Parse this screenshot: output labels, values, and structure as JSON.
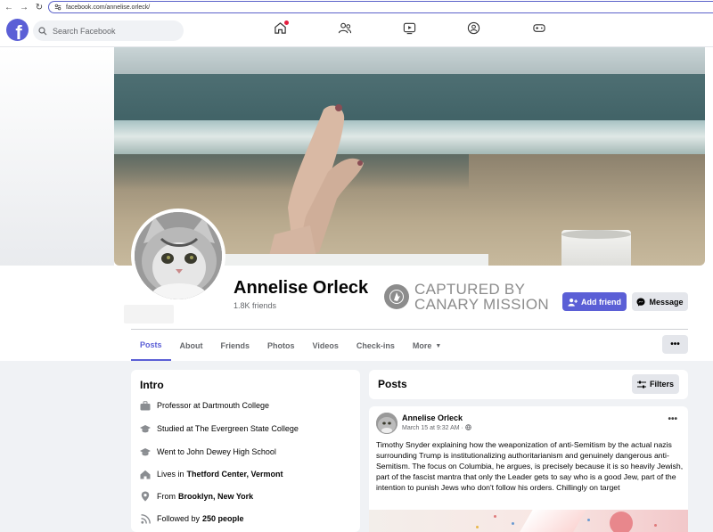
{
  "browser": {
    "url": "facebook.com/annelise.orleck/"
  },
  "header": {
    "search_placeholder": "Search Facebook"
  },
  "profile": {
    "name": "Annelise Orleck",
    "friends": "1.8K friends",
    "watermark_line1": "CAPTURED BY",
    "watermark_line2": "CANARY MISSION",
    "add_friend_label": "Add friend",
    "message_label": "Message"
  },
  "tabs": [
    {
      "label": "Posts",
      "active": true
    },
    {
      "label": "About"
    },
    {
      "label": "Friends"
    },
    {
      "label": "Photos"
    },
    {
      "label": "Videos"
    },
    {
      "label": "Check-ins"
    },
    {
      "label": "More"
    }
  ],
  "intro": {
    "title": "Intro",
    "items": [
      {
        "icon": "briefcase-icon",
        "text": "Professor at Dartmouth College",
        "bold": ""
      },
      {
        "icon": "graduation-cap-icon",
        "text": "Studied at The Evergreen State College",
        "bold": ""
      },
      {
        "icon": "graduation-cap-icon",
        "text": "Went to John Dewey High School",
        "bold": ""
      },
      {
        "icon": "home-icon",
        "text": "Lives in",
        "bold": "Thetford Center, Vermont"
      },
      {
        "icon": "location-pin-icon",
        "text": "From",
        "bold": "Brooklyn, New York"
      },
      {
        "icon": "rss-icon",
        "text": "Followed by",
        "bold": "250 people"
      }
    ]
  },
  "posts": {
    "title": "Posts",
    "filters_label": "Filters",
    "items": [
      {
        "author": "Annelise Orleck",
        "date": "March 15 at 9:32 AM",
        "text": "Timothy Snyder explaining how the weaponization of anti-Semitism by the actual nazis surrounding Trump is institutionalizing authoritarianism and genuinely dangerous anti-Semitism. The focus on Columbia, he argues, is precisely because it is so heavily Jewish, part of the fascist mantra that only the Leader gets to say who is a good Jew, part of the intention to punish Jews who don't follow his orders. Chillingly on target"
      }
    ]
  },
  "colors": {
    "accent": "#5b5fd6",
    "bg": "#f0f2f5"
  }
}
